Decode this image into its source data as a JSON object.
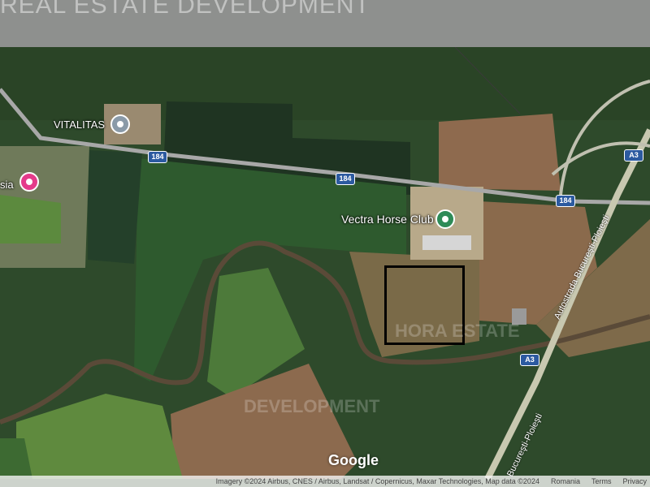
{
  "watermark_top": "REAL ESTATE DEVELOPMENT",
  "watermarks": [
    "HORA ESTATE",
    "DEVELOPMENT"
  ],
  "pois": [
    {
      "label": "VITALITAS",
      "color": "#8a9aa8",
      "icon": "location-pin-icon"
    },
    {
      "label": "Vectra Horse Club",
      "color": "#2e8b57",
      "icon": "location-pin-icon"
    },
    {
      "label": "sia",
      "color": "#e43a8a",
      "icon": "shop-pin-icon"
    }
  ],
  "road_shields": [
    "184",
    "184",
    "184",
    "A3",
    "A3"
  ],
  "road_names": [
    "Autostrada Bucureşti-Ploieşti",
    "Bucureşti-Ploieşti"
  ],
  "google_logo": "Google",
  "attribution": {
    "imagery": "Imagery ©2024 Airbus, CNES / Airbus, Landsat / Copernicus, Maxar Technologies, Map data ©2024",
    "country": "Romania",
    "terms": "Terms",
    "privacy": "Privacy"
  },
  "colors": {
    "poi_vitalitas": "#8a9aa8",
    "poi_vectra": "#2e8b57",
    "poi_sia": "#e43a8a",
    "highway_shield": "#2c5aa0",
    "selection_box": "#000000"
  }
}
